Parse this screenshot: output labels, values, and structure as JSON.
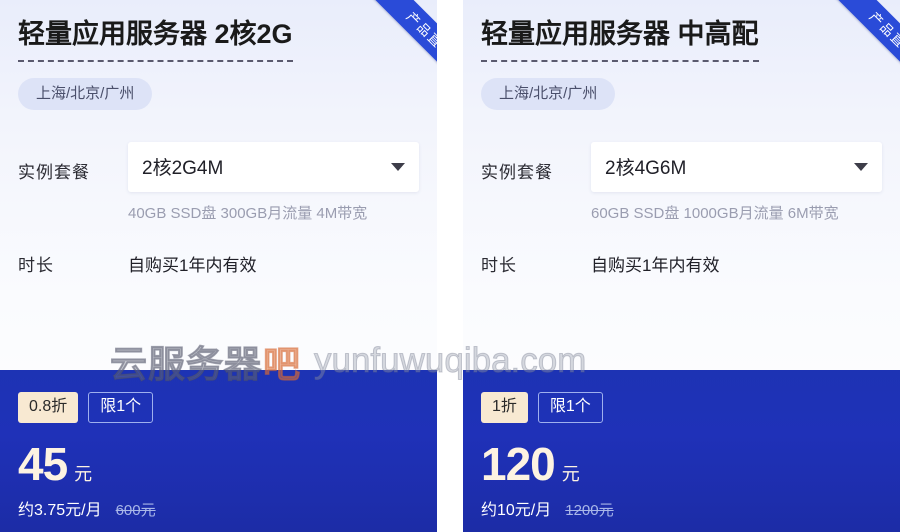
{
  "watermark": {
    "brand_cn": "云服务器",
    "brand_accent": "吧",
    "url": "yunfuwuqiba.com"
  },
  "cards": [
    {
      "ribbon": "产品直单",
      "title": "轻量应用服务器 2核2G",
      "region": "上海/北京/广州",
      "spec_label": "实例套餐",
      "spec_value": "2核2G4M",
      "spec_desc": "40GB SSD盘 300GB月流量 4M带宽",
      "duration_label": "时长",
      "duration_value": "自购买1年内有效",
      "discount_badge": "0.8折",
      "limit_badge": "限1个",
      "price": "45",
      "price_unit": "元",
      "price_month": "约3.75元/月",
      "price_original": "600元"
    },
    {
      "ribbon": "产品直单",
      "title": "轻量应用服务器 中高配",
      "region": "上海/北京/广州",
      "spec_label": "实例套餐",
      "spec_value": "2核4G6M",
      "spec_desc": "60GB SSD盘 1000GB月流量 6M带宽",
      "duration_label": "时长",
      "duration_value": "自购买1年内有效",
      "discount_badge": "1折",
      "limit_badge": "限1个",
      "price": "120",
      "price_unit": "元",
      "price_month": "约10元/月",
      "price_original": "1200元"
    }
  ],
  "colors": {
    "panel_blue": "#1f31b8",
    "ribbon_blue": "#2a4bd8",
    "badge_cream": "#f8e9d2",
    "price_cream": "#fdf3e2",
    "pill_bg": "#dde3f7"
  }
}
